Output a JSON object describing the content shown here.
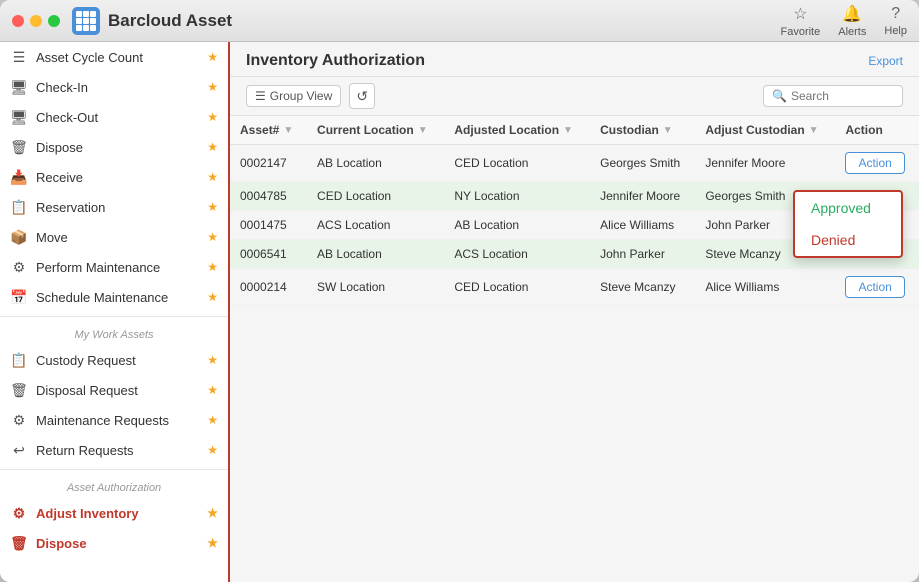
{
  "window": {
    "title": "Barcloud Asset",
    "controls": [
      "red",
      "yellow",
      "green"
    ]
  },
  "header": {
    "title": "Barcloud Asset",
    "actions": [
      {
        "label": "Favorite",
        "icon": "★"
      },
      {
        "label": "Alerts",
        "icon": "🔔"
      },
      {
        "label": "Help",
        "icon": "?"
      }
    ]
  },
  "sidebar": {
    "section_main_label": "",
    "section_work_label": "My Work Assets",
    "section_auth_label": "Asset Authorization",
    "items_main": [
      {
        "label": "Asset Cycle Count",
        "icon": "☰",
        "starred": true,
        "active": false
      },
      {
        "label": "Check-In",
        "icon": "💻",
        "starred": true,
        "active": false
      },
      {
        "label": "Check-Out",
        "icon": "🖥",
        "starred": true,
        "active": false
      },
      {
        "label": "Dispose",
        "icon": "🗑",
        "starred": true,
        "active": false
      },
      {
        "label": "Receive",
        "icon": "📥",
        "starred": true,
        "active": false
      },
      {
        "label": "Reservation",
        "icon": "📋",
        "starred": true,
        "active": false
      },
      {
        "label": "Move",
        "icon": "📦",
        "starred": true,
        "active": false
      },
      {
        "label": "Perform Maintenance",
        "icon": "⚙",
        "starred": true,
        "active": false
      },
      {
        "label": "Schedule Maintenance",
        "icon": "📅",
        "starred": true,
        "active": false
      }
    ],
    "items_work": [
      {
        "label": "Custody Request",
        "icon": "📋",
        "starred": true,
        "active": false
      },
      {
        "label": "Disposal Request",
        "icon": "🗑",
        "starred": true,
        "active": false
      },
      {
        "label": "Maintenance Requests",
        "icon": "⚙",
        "starred": true,
        "active": false
      },
      {
        "label": "Return Requests",
        "icon": "↩",
        "starred": true,
        "active": false
      }
    ],
    "items_auth": [
      {
        "label": "Adjust Inventory",
        "icon": "⚙",
        "starred": true,
        "active": true
      },
      {
        "label": "Dispose",
        "icon": "🗑",
        "starred": true,
        "active": true
      }
    ]
  },
  "main": {
    "title": "Inventory Authorization",
    "export_label": "Export",
    "toolbar": {
      "group_view_label": "Group View",
      "refresh_icon": "↺",
      "search_placeholder": "Search"
    },
    "table": {
      "columns": [
        "Asset#",
        "Current Location",
        "Adjusted Location",
        "Custodian",
        "Adjust Custodian",
        "Action"
      ],
      "rows": [
        {
          "asset": "0002147",
          "current_location": "AB Location",
          "adjusted_location": "CED Location",
          "custodian": "Georges Smith",
          "adjust_custodian": "Jennifer Moore",
          "action": "Action"
        },
        {
          "asset": "0004785",
          "current_location": "CED Location",
          "adjusted_location": "NY Location",
          "custodian": "Jennifer Moore",
          "adjust_custodian": "Georges Smith",
          "action": ""
        },
        {
          "asset": "0001475",
          "current_location": "ACS Location",
          "adjusted_location": "AB Location",
          "custodian": "Alice Williams",
          "adjust_custodian": "John Parker",
          "action": ""
        },
        {
          "asset": "0006541",
          "current_location": "AB Location",
          "adjusted_location": "ACS Location",
          "custodian": "John Parker",
          "adjust_custodian": "Steve Mcanzy",
          "action": ""
        },
        {
          "asset": "0000214",
          "current_location": "SW Location",
          "adjusted_location": "CED Location",
          "custodian": "Steve Mcanzy",
          "adjust_custodian": "Alice Williams",
          "action": "Action"
        }
      ]
    },
    "dropdown": {
      "items": [
        {
          "label": "Approved",
          "type": "approved"
        },
        {
          "label": "Denied",
          "type": "denied"
        }
      ]
    }
  }
}
